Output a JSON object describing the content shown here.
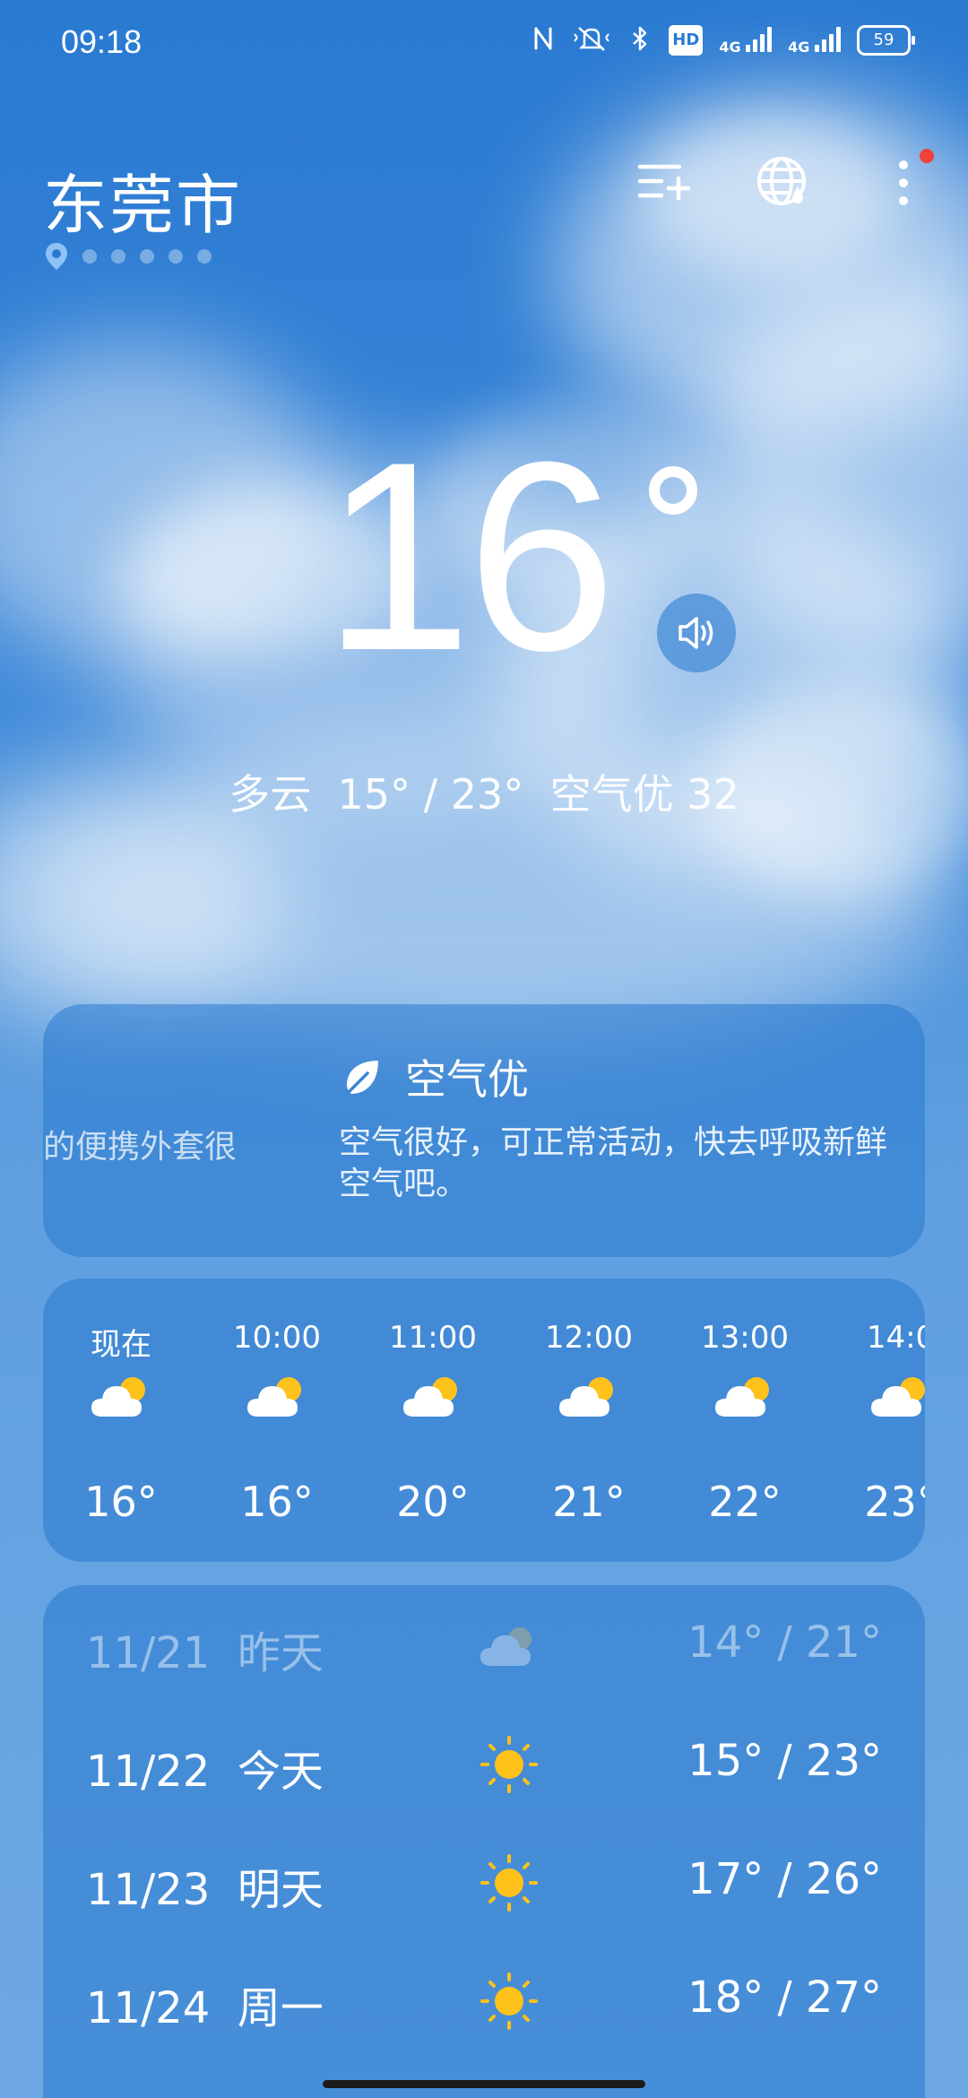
{
  "status_bar": {
    "time": "09:18",
    "hd_badge": "HD",
    "net1": "4G",
    "net2": "4G",
    "battery": "59",
    "icons": [
      "nfc-icon",
      "mute-icon",
      "bluetooth-icon",
      "hd-icon",
      "signal-icon",
      "signal-icon",
      "battery-icon"
    ]
  },
  "header": {
    "city": "东莞市",
    "page_count": 6,
    "active_page": 0,
    "actions": [
      "add-city-icon",
      "globe-icon",
      "more-icon"
    ]
  },
  "current": {
    "temperature": "16",
    "summary": "多云  15° / 23°  空气优 32"
  },
  "air_quality": {
    "left_text": "的便携外套很",
    "title": "空气优",
    "description": "空气很好，可正常活动，快去呼吸新鲜空气吧。"
  },
  "hourly": [
    {
      "label": "现在",
      "icon": "partly-cloudy-icon",
      "temp": "16°"
    },
    {
      "label": "10:00",
      "icon": "partly-cloudy-icon",
      "temp": "16°"
    },
    {
      "label": "11:00",
      "icon": "partly-cloudy-icon",
      "temp": "20°"
    },
    {
      "label": "12:00",
      "icon": "partly-cloudy-icon",
      "temp": "21°"
    },
    {
      "label": "13:00",
      "icon": "partly-cloudy-icon",
      "temp": "22°"
    },
    {
      "label": "14:0",
      "icon": "partly-cloudy-icon",
      "temp": "23°"
    }
  ],
  "daily": [
    {
      "date": "11/21  昨天",
      "icon": "cloudy-icon",
      "temp": "14° / 21°",
      "past": true
    },
    {
      "date": "11/22  今天",
      "icon": "sun-icon",
      "temp": "15° / 23°",
      "past": false
    },
    {
      "date": "11/23  明天",
      "icon": "sun-icon",
      "temp": "17° / 26°",
      "past": false
    },
    {
      "date": "11/24  周一",
      "icon": "sun-icon",
      "temp": "18° / 27°",
      "past": false
    }
  ],
  "colors": {
    "sky_top": "#2a7ad2",
    "card_bg": "rgba(40,120,205,0.55)",
    "sun": "#ffc21a",
    "notification_dot": "#f0413a"
  }
}
